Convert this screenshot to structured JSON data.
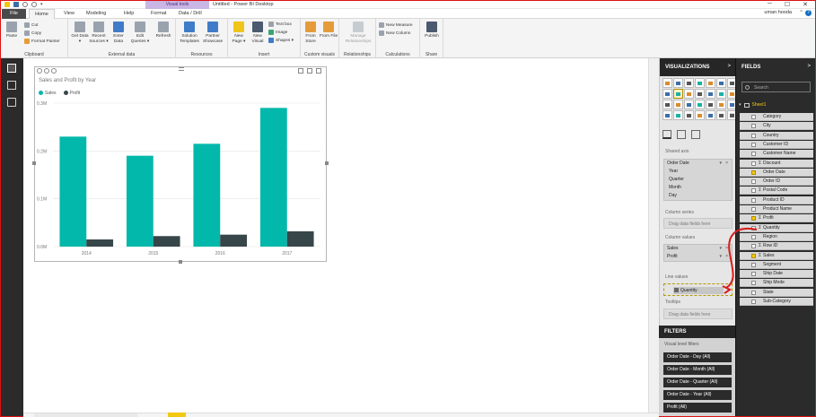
{
  "titlebar": {
    "contextual_tab": "Visual tools",
    "window_title": "Untitled - Power BI Desktop",
    "min": "─",
    "max": "☐",
    "close": "✕",
    "qat_caret": "▾"
  },
  "tabs": [
    {
      "label": "File"
    },
    {
      "label": "Home"
    },
    {
      "label": "View"
    },
    {
      "label": "Modeling"
    },
    {
      "label": "Help"
    },
    {
      "label": "Format"
    },
    {
      "label": "Data / Drill"
    }
  ],
  "user": {
    "name": "uman hooda",
    "caret": "^",
    "help": "?"
  },
  "ribbon": {
    "clipboard": {
      "paste": "Paste",
      "cut": "Cut",
      "copy": "Copy",
      "format_painter": "Format Painter",
      "label": "Clipboard"
    },
    "external": {
      "get_data": "Get Data ▾",
      "recent_sources": "Recent Sources ▾",
      "enter_data": "Enter Data",
      "edit_queries": "Edit Queries ▾",
      "refresh": "Refresh",
      "label": "External data"
    },
    "resources": {
      "solution_templates": "Solution Templates",
      "partner_showcase": "Partner Showcase",
      "label": "Resources"
    },
    "insert": {
      "new_page": "New Page ▾",
      "new_visual": "New Visual",
      "text_box": "Text box",
      "image": "Image",
      "shapes": "Shapes ▾",
      "label": "Insert"
    },
    "custom_visuals": {
      "from_store": "From Store",
      "from_file": "From File",
      "label": "Custom visuals"
    },
    "relationships": {
      "manage": "Manage Relationships",
      "label": "Relationships"
    },
    "calculations": {
      "new_measure": "New Measure",
      "new_column": "New Column",
      "label": "Calculations"
    },
    "share": {
      "publish": "Publish",
      "label": "Share"
    }
  },
  "visual": {
    "title": "Sales and Profit by Year",
    "legend": [
      {
        "name": "Sales",
        "color": "#01b8aa"
      },
      {
        "name": "Profit",
        "color": "#374649"
      }
    ]
  },
  "chart_data": {
    "type": "bar",
    "title": "Sales and Profit by Year",
    "categories": [
      "2014",
      "2015",
      "2016",
      "2017"
    ],
    "series": [
      {
        "name": "Sales",
        "values": [
          0.23,
          0.19,
          0.215,
          0.29
        ],
        "color": "#01b8aa"
      },
      {
        "name": "Profit",
        "values": [
          0.015,
          0.022,
          0.025,
          0.032
        ],
        "color": "#374649"
      }
    ],
    "yticks": [
      "0.0M",
      "0.1M",
      "0.2M",
      "0.3M"
    ],
    "ylim": [
      0,
      0.3
    ],
    "grid": true,
    "legend_position": "top-left"
  },
  "visualizations": {
    "header": "VISUALIZATIONS",
    "chevron": ">",
    "shared_axis": "Shared axis",
    "axis_items": [
      {
        "label": "Order Date",
        "sub": false
      },
      {
        "label": "Year",
        "sub": true
      },
      {
        "label": "Quarter",
        "sub": true
      },
      {
        "label": "Month",
        "sub": true
      },
      {
        "label": "Day",
        "sub": true
      }
    ],
    "column_series": "Column series",
    "column_series_drop": "Drag data fields here",
    "column_values": "Column values",
    "column_value_items": [
      {
        "label": "Sales"
      },
      {
        "label": "Profit"
      }
    ],
    "line_values": "Line values",
    "line_value_item": "Quantity",
    "tooltips": "Tooltips",
    "tooltips_drop": "Drag data fields here",
    "remove_glyph": "×",
    "more_glyph": "▾",
    "more_visuals": "···"
  },
  "filters": {
    "header": "FILTERS",
    "visual_level": "Visual level filters",
    "items": [
      "Order Date - Day (All)",
      "Order Date - Month (All)",
      "Order Date - Quarter (All)",
      "Order Date - Year (All)",
      "Profit (All)"
    ]
  },
  "fields": {
    "header": "FIELDS",
    "chevron": ">",
    "search_placeholder": "Search",
    "table_caret": "▾",
    "table_name": "Sheet1",
    "sigma": "Σ",
    "items": [
      {
        "label": "Category",
        "checked": false,
        "sigma": false
      },
      {
        "label": "City",
        "checked": false,
        "sigma": false
      },
      {
        "label": "Country",
        "checked": false,
        "sigma": false
      },
      {
        "label": "Customer ID",
        "checked": false,
        "sigma": false
      },
      {
        "label": "Customer Name",
        "checked": false,
        "sigma": false
      },
      {
        "label": "Discount",
        "checked": false,
        "sigma": true
      },
      {
        "label": "Order Date",
        "checked": true,
        "sigma": false
      },
      {
        "label": "Order ID",
        "checked": false,
        "sigma": false
      },
      {
        "label": "Postal Code",
        "checked": false,
        "sigma": true
      },
      {
        "label": "Product ID",
        "checked": false,
        "sigma": false
      },
      {
        "label": "Product Name",
        "checked": false,
        "sigma": false
      },
      {
        "label": "Profit",
        "checked": true,
        "sigma": true
      },
      {
        "label": "Quantity",
        "checked": false,
        "sigma": true
      },
      {
        "label": "Region",
        "checked": false,
        "sigma": false
      },
      {
        "label": "Row ID",
        "checked": false,
        "sigma": true
      },
      {
        "label": "Sales",
        "checked": true,
        "sigma": true
      },
      {
        "label": "Segment",
        "checked": false,
        "sigma": false
      },
      {
        "label": "Ship Date",
        "checked": false,
        "sigma": false
      },
      {
        "label": "Ship Mode",
        "checked": false,
        "sigma": false
      },
      {
        "label": "State",
        "checked": false,
        "sigma": false
      },
      {
        "label": "Sub-Category",
        "checked": false,
        "sigma": false
      }
    ]
  },
  "colors": {
    "accent": "#f2c811",
    "annotation": "#d91c1c",
    "dark_pane": "#2b2b2b"
  }
}
